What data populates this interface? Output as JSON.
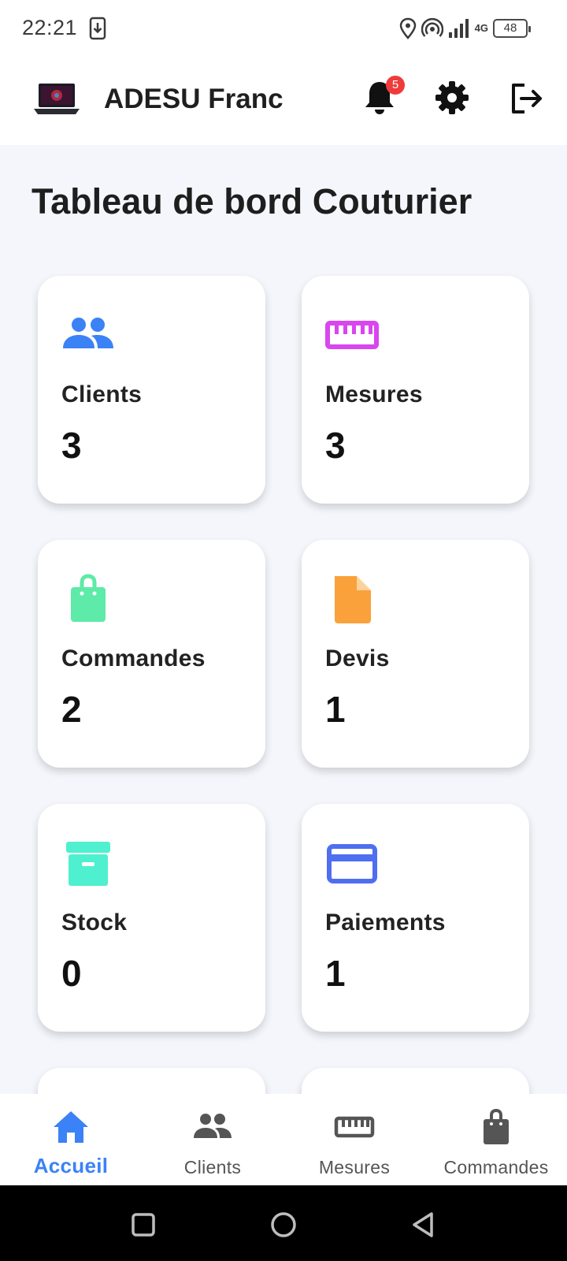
{
  "status_bar": {
    "time": "22:21",
    "network": "4G",
    "battery": "48"
  },
  "app_bar": {
    "title": "ADESU Franc",
    "notification_count": "5"
  },
  "page": {
    "title": "Tableau de bord Couturier"
  },
  "cards": [
    {
      "label": "Clients",
      "value": "3",
      "icon": "people-icon",
      "color": "#3b82f6"
    },
    {
      "label": "Mesures",
      "value": "3",
      "icon": "ruler-icon",
      "color": "#d946ef"
    },
    {
      "label": "Commandes",
      "value": "2",
      "icon": "shopping-bag-icon",
      "color": "#5eeaa8"
    },
    {
      "label": "Devis",
      "value": "1",
      "icon": "document-icon",
      "color": "#fba13b"
    },
    {
      "label": "Stock",
      "value": "0",
      "icon": "archive-box-icon",
      "color": "#4ff0cf"
    },
    {
      "label": "Paiements",
      "value": "1",
      "icon": "credit-card-icon",
      "color": "#4f6ff0"
    }
  ],
  "bottom_nav": [
    {
      "label": "Accueil",
      "icon": "home-icon",
      "active": true
    },
    {
      "label": "Clients",
      "icon": "people-icon",
      "active": false
    },
    {
      "label": "Mesures",
      "icon": "ruler-icon",
      "active": false
    },
    {
      "label": "Commandes",
      "icon": "shopping-bag-icon",
      "active": false
    }
  ],
  "colors": {
    "accent": "#3b82f6",
    "background": "#f4f6fb",
    "badge": "#ef3b3b"
  }
}
